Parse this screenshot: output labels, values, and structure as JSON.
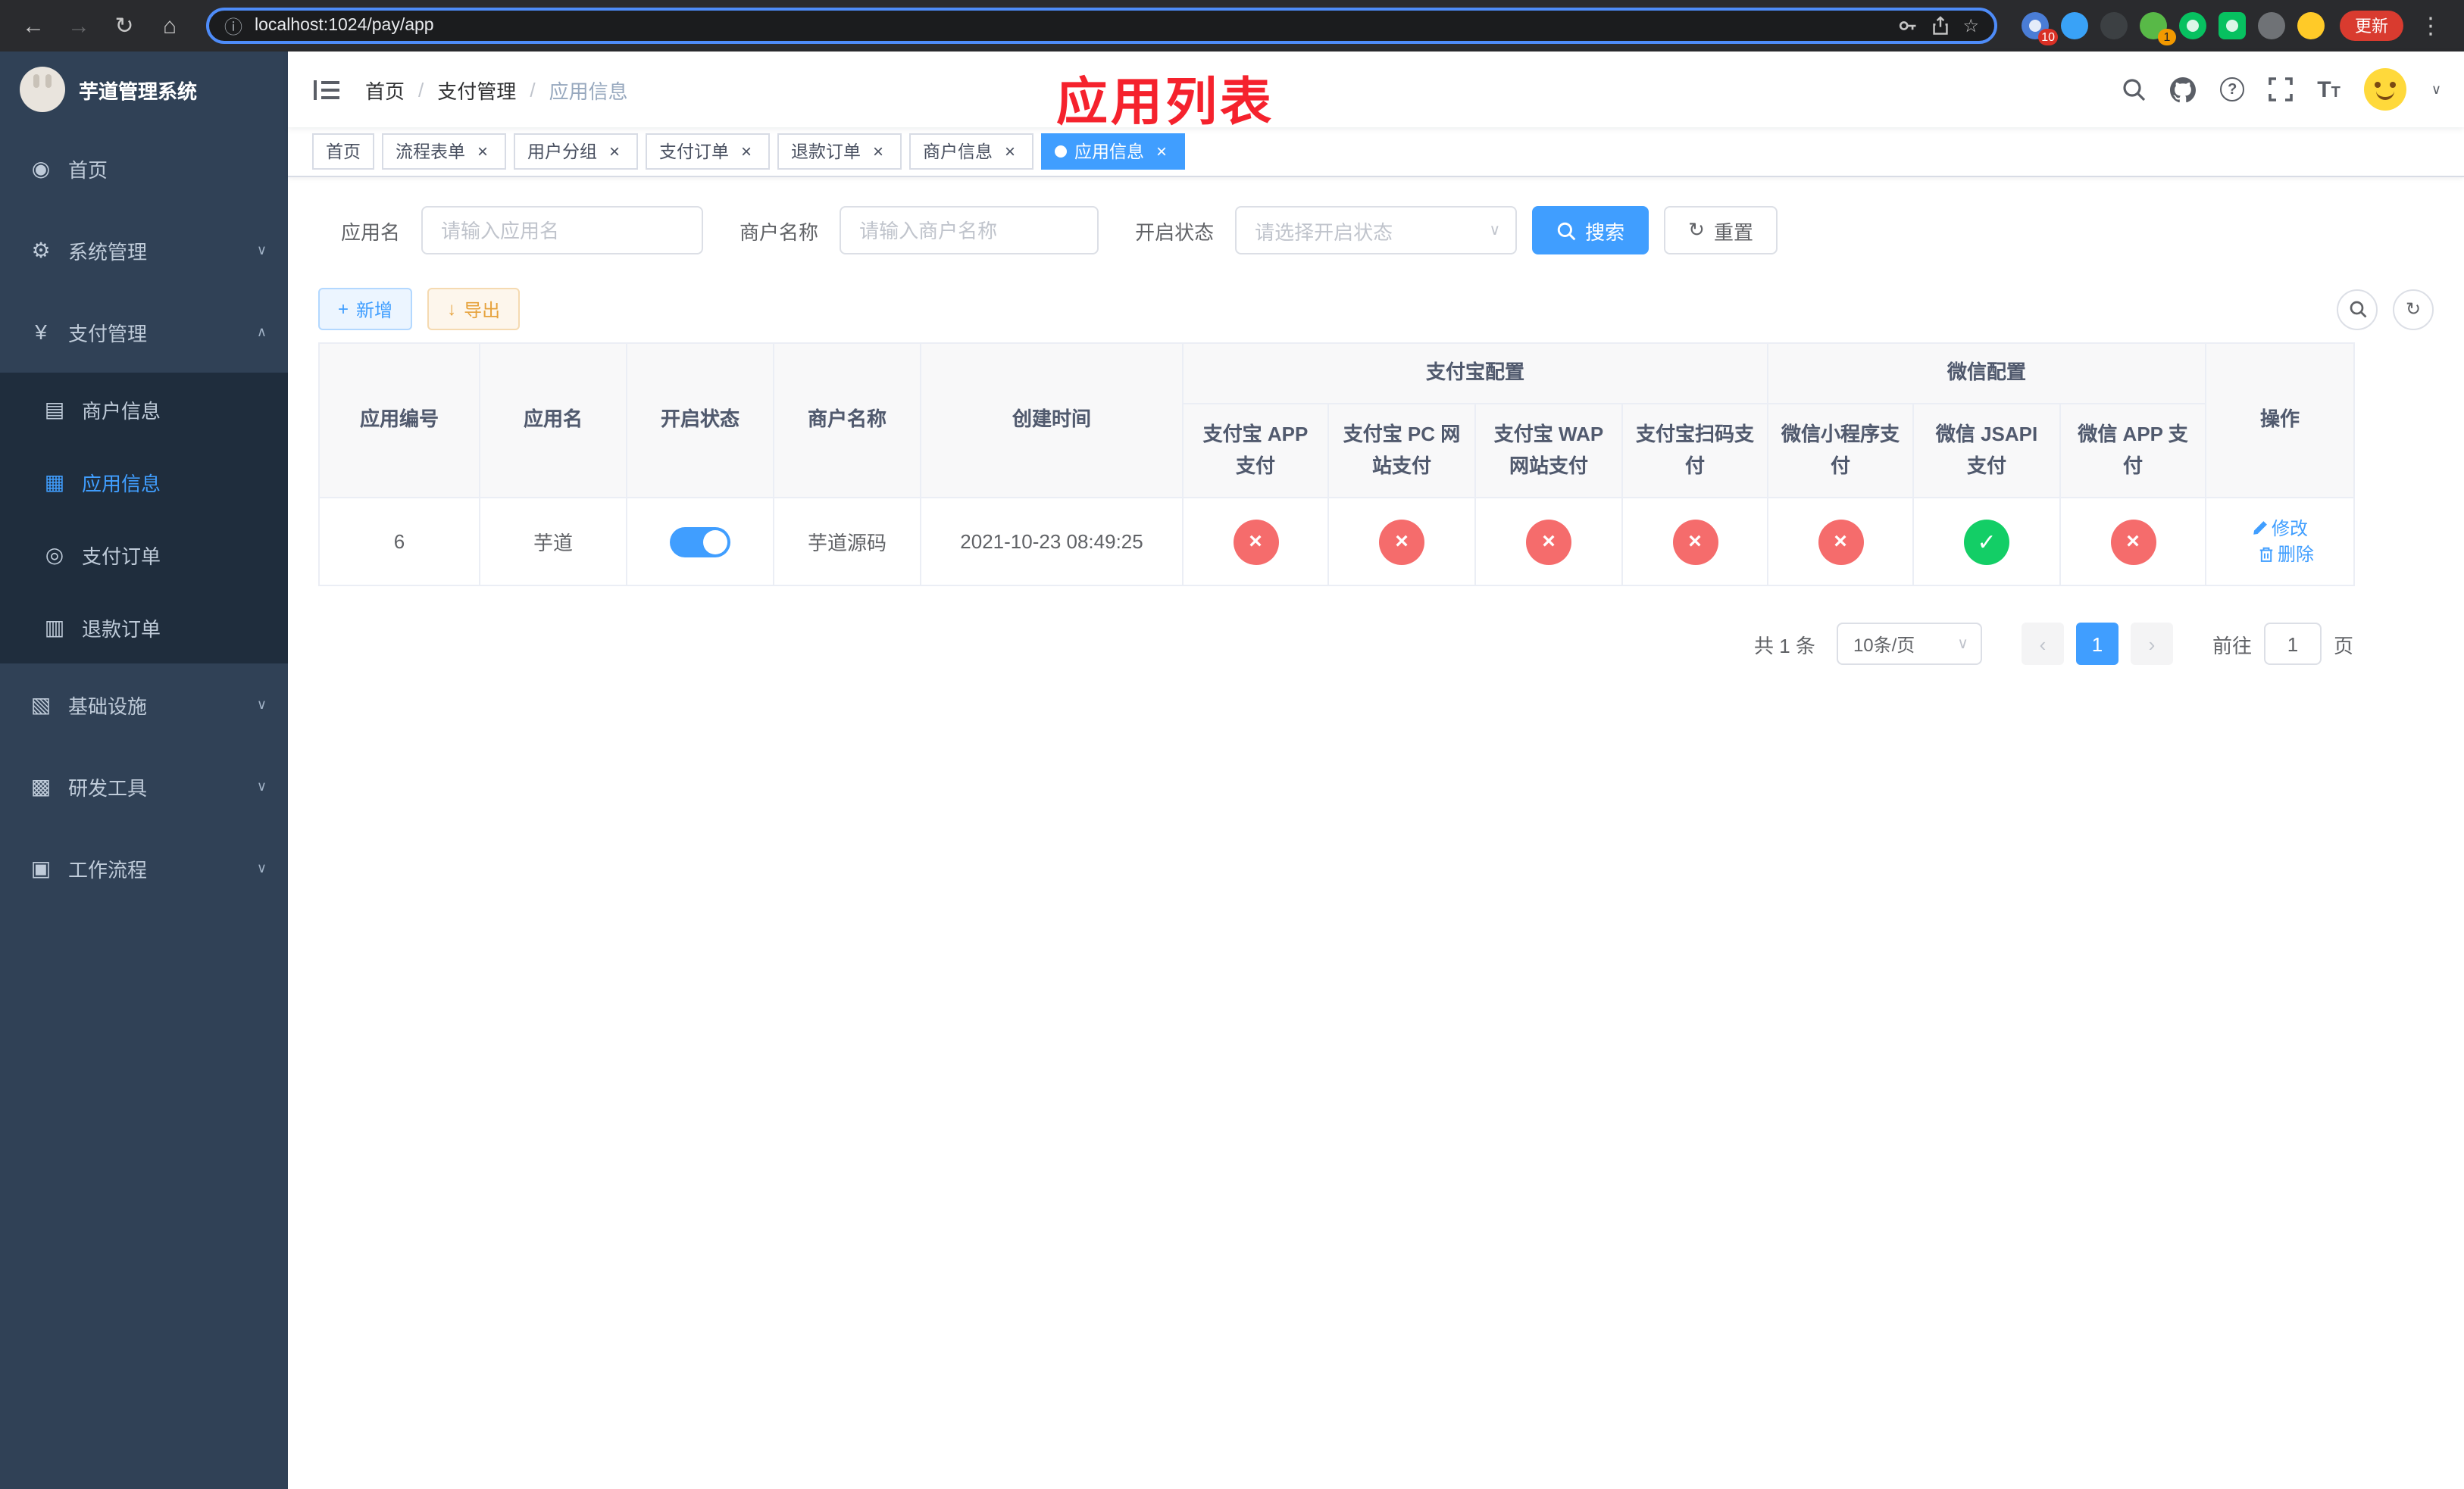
{
  "glyphs": {
    "back": "←",
    "forward": "→",
    "reload": "↻",
    "home": "⌂",
    "info": "ⓘ",
    "star": "☆",
    "dots": "⋮",
    "close": "×",
    "check": "✓",
    "cross": "×",
    "caret_down": "∨",
    "caret_up": "∧",
    "select_caret": "▾",
    "prev": "‹",
    "next": "›",
    "plus": "+",
    "download": "↓",
    "refresh": "↻",
    "question": "?",
    "menu_home": "◉",
    "menu_system": "⚙",
    "menu_pay": "¥",
    "menu_merchant": "▤",
    "menu_app": "▦",
    "menu_order": "◎",
    "menu_refund": "▥",
    "menu_infra": "▧",
    "menu_devtool": "▩",
    "menu_flow": "▣"
  },
  "colors": {
    "accent": "#409eff",
    "danger": "#f56c6c",
    "success": "#13ce66",
    "warning": "#e6a23c",
    "annotation_red": "#f5222d",
    "sidebar_bg": "#304156",
    "submenu_bg": "#1f2d3d"
  },
  "browser": {
    "url": "localhost:1024/pay/app",
    "update_label": "更新",
    "ext_badge_puzzle": "10",
    "ext_badge_avatar": "1"
  },
  "annotation": {
    "text": "应用列表"
  },
  "sidebar": {
    "logo_title": "芋道管理系统",
    "menu": [
      {
        "label": "首页"
      },
      {
        "label": "系统管理"
      },
      {
        "label": "支付管理"
      },
      {
        "label": "商户信息"
      },
      {
        "label": "应用信息"
      },
      {
        "label": "支付订单"
      },
      {
        "label": "退款订单"
      },
      {
        "label": "基础设施"
      },
      {
        "label": "研发工具"
      },
      {
        "label": "工作流程"
      }
    ]
  },
  "navbar": {
    "breadcrumb": {
      "items": [
        "首页",
        "支付管理",
        "应用信息"
      ],
      "separator": "/"
    }
  },
  "tabs": [
    {
      "label": "首页"
    },
    {
      "label": "流程表单"
    },
    {
      "label": "用户分组"
    },
    {
      "label": "支付订单"
    },
    {
      "label": "退款订单"
    },
    {
      "label": "商户信息"
    },
    {
      "label": "应用信息"
    }
  ],
  "filters": {
    "app_name_label": "应用名",
    "app_name_placeholder": "请输入应用名",
    "merchant_label": "商户名称",
    "merchant_placeholder": "请输入商户名称",
    "status_label": "开启状态",
    "status_placeholder": "请选择开启状态",
    "search_button": "搜索",
    "reset_button": "重置"
  },
  "toolbar": {
    "add_button": "新增",
    "export_button": "导出"
  },
  "table": {
    "headers": {
      "app_id": "应用编号",
      "app_name": "应用名",
      "status": "开启状态",
      "merchant": "商户名称",
      "created": "创建时间",
      "alipay_group": "支付宝配置",
      "wechat_group": "微信配置",
      "alipay_app": "支付宝 APP 支付",
      "alipay_pc": "支付宝 PC 网站支付",
      "alipay_wap": "支付宝 WAP 网站支付",
      "alipay_qr": "支付宝扫码支付",
      "wx_lite": "微信小程序支付",
      "wx_jsapi": "微信 JSAPI 支付",
      "wx_app": "微信 APP 支付",
      "actions": "操作"
    },
    "actions": {
      "edit": "修改",
      "delete": "删除"
    },
    "rows": [
      {
        "id": "6",
        "name": "芋道",
        "enabled": true,
        "merchant": "芋道源码",
        "created": "2021-10-23 08:49:25",
        "alipay_app": false,
        "alipay_pc": false,
        "alipay_wap": false,
        "alipay_qr": false,
        "wx_lite": false,
        "wx_jsapi": true,
        "wx_app": false
      }
    ]
  },
  "pagination": {
    "total_text": "共 1 条",
    "page_size_text": "10条/页",
    "page": "1",
    "goto_prefix": "前往",
    "goto_value": "1",
    "goto_suffix": "页"
  }
}
